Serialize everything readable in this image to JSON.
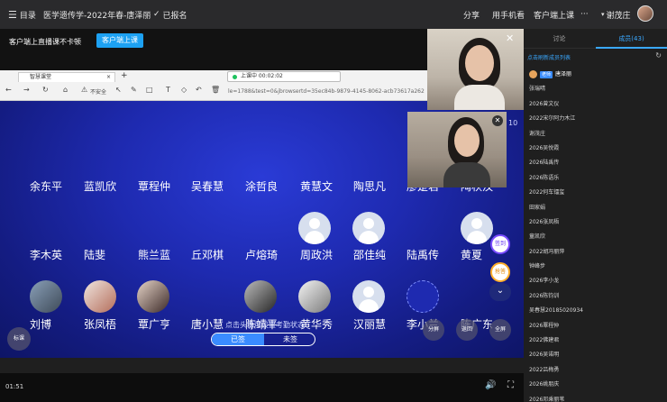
{
  "topbar": {
    "menu_icon": "menu-icon",
    "catalog_label": "目录",
    "course_title": "医学遗传学-2022年春-唐泽丽",
    "signed_label": "已报名",
    "share_label": "分享",
    "phone_label": "用手机看",
    "client_label": "客户端上课",
    "more_label": "···",
    "username": "谢茂庄"
  },
  "live": {
    "strip_text": "客户端上直播课不卡顿",
    "strip_button": "客户端上课",
    "browser_tab": "智慧课堂",
    "share_status": "上课中 00:02:02",
    "url_fragment": "le=1788&test=0&jbrowsertd=35ec84b-9879-4145-8062-acb73617a262",
    "not_secure": "不安全",
    "slide_page": "10"
  },
  "names_row1": [
    "余东平",
    "蓝凯欣",
    "覃程仲",
    "吴春慧",
    "涂哲良",
    "黄慧文",
    "陶思凡",
    "廖楚君",
    "陶秋汉"
  ],
  "names_row2": [
    "李木英",
    "陆斐",
    "熊兰蓝",
    "丘邓棋",
    "卢熔琦",
    "周政洪",
    "邵佳纯",
    "陆禹传",
    "黄夏"
  ],
  "names_row3": [
    "刘博",
    "张凤梧",
    "覃广亨",
    "唐小慧",
    "陈靖平",
    "黄华秀",
    "汉丽慧",
    "李小兰",
    "陈广东"
  ],
  "float_buttons": {
    "sign": "签到",
    "pick": "抢答"
  },
  "round_buttons": {
    "group": "分屏",
    "back": "返回",
    "all": "全屏"
  },
  "mark_label": "标课",
  "segment": {
    "signed": "已签",
    "unsigned": "未签"
  },
  "hint": "点击头像可设置考勤状态",
  "player": {
    "time": "01:51"
  },
  "side": {
    "tab_discuss": "讨论",
    "tab_members": "成员(43)",
    "search_label": "点击刷新成员列表",
    "teacher_badge": "老师",
    "members": [
      "唐泽丽",
      "张瑞晴",
      "2026曾文仪",
      "2022宋尔阿力木江",
      "谢茂庄",
      "2026吴悦霞",
      "2026陆禹传",
      "2026陈语乐",
      "2022何车镭玺",
      "田家娟",
      "2026张凤梧",
      "童凯欣",
      "2022胡冯丽萍",
      "钟峰步",
      "2026李小龙",
      "2026陈钧训",
      "吴春慧20185020934",
      "2026覃程仲",
      "2022佛建君",
      "2026吴诺明",
      "2022吕梅勇",
      "2026姚朋庆",
      "2026邓乘丽苇"
    ]
  }
}
